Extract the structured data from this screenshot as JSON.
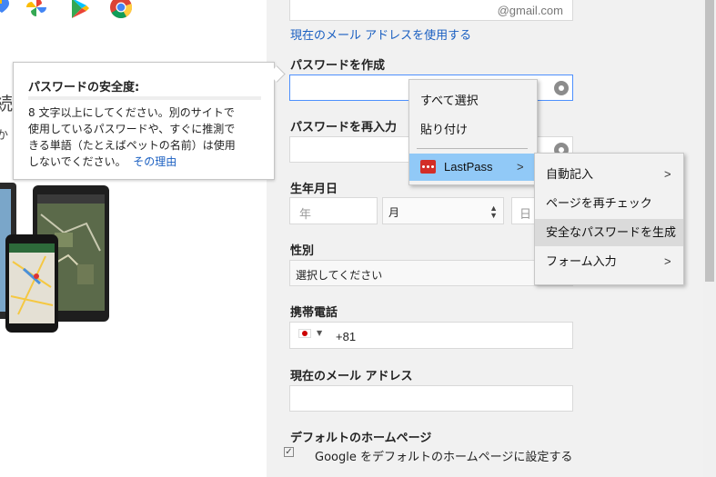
{
  "form": {
    "email_suffix": "@gmail.com",
    "use_current_email_link": "現在のメール アドレスを使用する",
    "create_password_label": "パスワードを作成",
    "confirm_password_label": "パスワードを再入力",
    "birthday_label": "生年月日",
    "birth_year_placeholder": "年",
    "birth_month_value": "月",
    "birth_day_placeholder": "日",
    "gender_label": "性別",
    "gender_value": "選択してください",
    "mobile_label": "携帯電話",
    "country_code": "+81",
    "current_email_label": "現在のメール アドレス",
    "homepage_label": "デフォルトのホームページ",
    "homepage_checkbox_label": "Google をデフォルトのホームページに設定する"
  },
  "tooltip": {
    "title": "パスワードの安全度:",
    "body_lines": [
      "8 文字以上にしてください。別のサイトで",
      "使用しているパスワードや、すぐに推測で",
      "きる単語（たとえばペットの名前）は使用",
      "しないでください。"
    ],
    "link": "その理由"
  },
  "left_fragments": {
    "char1": "続",
    "char2": "か"
  },
  "context_menu": {
    "select_all": "すべて選択",
    "paste": "貼り付け",
    "lastpass": "LastPass"
  },
  "submenu": {
    "autofill": "自動記入",
    "recheck_page": "ページを再チェック",
    "generate_password": "安全なパスワードを生成",
    "fill_forms": "フォーム入力"
  },
  "colors": {
    "link": "#1a5fc1",
    "menu_highlight": "#91c9f7",
    "lastpass_red": "#d32d27",
    "submenu_hover": "#dadada"
  }
}
